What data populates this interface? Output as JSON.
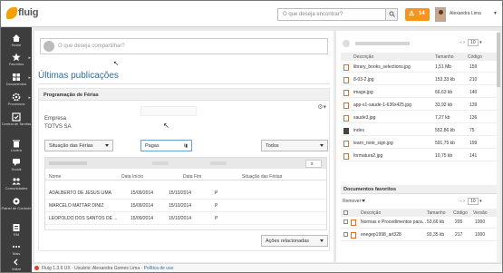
{
  "app": {
    "logo_text": "fluig"
  },
  "header": {
    "search_placeholder": "O que deseja encontrar?",
    "notifications": "14",
    "user_name": "Alexandra Lima"
  },
  "sidebar": {
    "items": [
      {
        "label": "Home",
        "icon": "home-icon"
      },
      {
        "label": "Favoritos",
        "icon": "star-icon"
      },
      {
        "label": "Documentos",
        "icon": "documents-icon"
      },
      {
        "label": "Processos",
        "icon": "process-icon"
      },
      {
        "label": "Central de Tarefas",
        "icon": "tasks-icon"
      },
      {
        "label": "Lixeira",
        "icon": "trash-icon"
      },
      {
        "label": "Social",
        "icon": "social-icon"
      },
      {
        "label": "Comunidades",
        "icon": "communities-icon"
      },
      {
        "label": "Painel de Controle",
        "icon": "control-panel-icon"
      },
      {
        "label": "RM",
        "icon": "rm-icon"
      },
      {
        "label": "Mais",
        "icon": "more-icon"
      },
      {
        "label": "Voltar",
        "icon": "back-icon"
      }
    ]
  },
  "feed": {
    "share_placeholder": "O que deseja compartilhar?",
    "title": "Últimas publicações"
  },
  "widget": {
    "title": "Programação de Férias",
    "company_label": "Empresa",
    "company_value": "TOTVS SA",
    "filter_status": "Situação das Férias",
    "filter_pagas": "Pagas",
    "filter_todos": "Todos",
    "search_char": "s",
    "columns": [
      "Nome",
      "Data Início",
      "Data Fim",
      "Situação das Férias"
    ],
    "rows": [
      [
        "ADALBERTO DE JESUS LIMA",
        "15/09/2014",
        "15/10/2014",
        "P"
      ],
      [
        "MARCELO MATTAR DINIZ",
        "15/09/2014",
        "15/10/2014",
        "P"
      ],
      [
        "LEOPOLDO DOS SANTOS DE ...",
        "15/09/2014",
        "15/10/2014",
        "P"
      ]
    ],
    "related_actions": "Ações relacionadas"
  },
  "files": {
    "page_size": "10",
    "columns": [
      "Descrição",
      "Tamanho",
      "Código"
    ],
    "rows": [
      {
        "name": "library_books_selections.jpg",
        "size": "1,51 Mb",
        "code": "159",
        "dark": false
      },
      {
        "name": "8-03-2.jpg",
        "size": "153,33 kb",
        "code": "210",
        "dark": false
      },
      {
        "name": "image.jpg",
        "size": "66,63 kb",
        "code": "140",
        "dark": false
      },
      {
        "name": "app-s1-saude-1-636x425.jpg",
        "size": "33,92 kb",
        "code": "139",
        "dark": false
      },
      {
        "name": "saude3.jpg",
        "size": "7,27 kb",
        "code": "136",
        "dark": false
      },
      {
        "name": "index",
        "size": "552,86 kb",
        "code": "75",
        "dark": true
      },
      {
        "name": "learn_note_sign.jpg",
        "size": "591,75 kb",
        "code": "199",
        "dark": false
      },
      {
        "name": "formatura2.jpg",
        "size": "10,75 kb",
        "code": "141",
        "dark": false
      }
    ]
  },
  "favorites": {
    "title": "Documentos favoritos",
    "remove_label": "Remover",
    "page_size": "10",
    "columns": [
      "Descrição",
      "Tamanho",
      "Código",
      "Versão"
    ],
    "rows": [
      {
        "name": "Normas e Procedimentos para...",
        "size": "53,66 kb",
        "code": "205",
        "version": "1000"
      },
      {
        "name": "enegep1998_art328",
        "size": "93,35 kb",
        "code": "217",
        "version": "1000"
      }
    ]
  },
  "footer": {
    "text": "Fluig 1.3.6 UX · Usuário: Alexandra Gomes Lima ·",
    "link": "Política de uso"
  },
  "colors": {
    "accent": "#2d6ca2",
    "notification": "#f7941d",
    "sidebar": "#3d3d3d",
    "logo": "#f5a000"
  }
}
